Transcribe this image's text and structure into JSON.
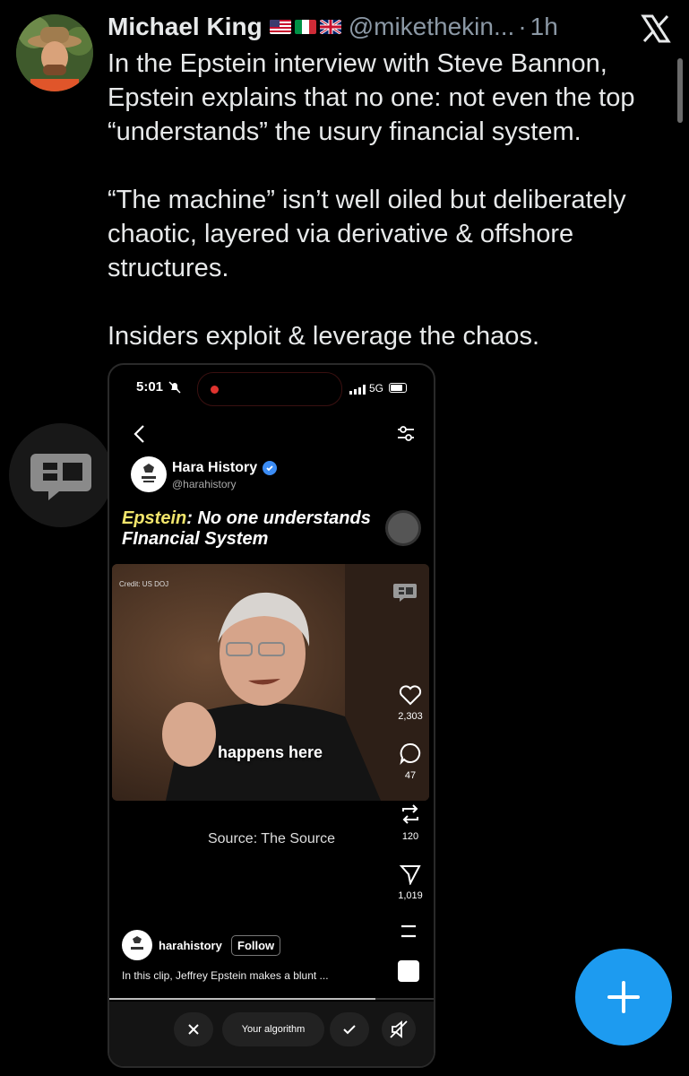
{
  "tweet": {
    "author_name": "Michael King",
    "author_handle": "@mikethekin...",
    "separator": "·",
    "time": "1h",
    "paragraphs": [
      "In the Epstein interview with Steve Bannon, Epstein explains that no one: not even the top “understands” the usury financial system.",
      "“The machine” isn’t well oiled but deliberately chaotic, layered via derivative & offshore structures.",
      "Insiders exploit & leverage the chaos."
    ],
    "flags": [
      "us-flag",
      "italy-flag",
      "uk-flag"
    ]
  },
  "embed": {
    "status": {
      "time": "5:01",
      "network": "5G"
    },
    "channel": {
      "name": "Hara History",
      "handle": "@harahistory"
    },
    "title_highlight": "Epstein",
    "title_rest": ": No one understands",
    "title_line2": "FInancial System",
    "video": {
      "credit": "Credit: US DOJ",
      "caption": "happens here"
    },
    "actions": [
      {
        "name": "like",
        "count": "2,303"
      },
      {
        "name": "comment",
        "count": "47"
      },
      {
        "name": "repost",
        "count": "120"
      },
      {
        "name": "share",
        "count": "1,019"
      }
    ],
    "source_label": "Source",
    "source_sep": ":",
    "source_value": "The Source",
    "footer": {
      "account": "harahistory",
      "follow_label": "Follow",
      "description": "In this clip, Jeffrey Epstein makes a blunt ..."
    },
    "bottom": {
      "algorithm_label": "Your algorithm"
    },
    "progress": 0.82
  }
}
